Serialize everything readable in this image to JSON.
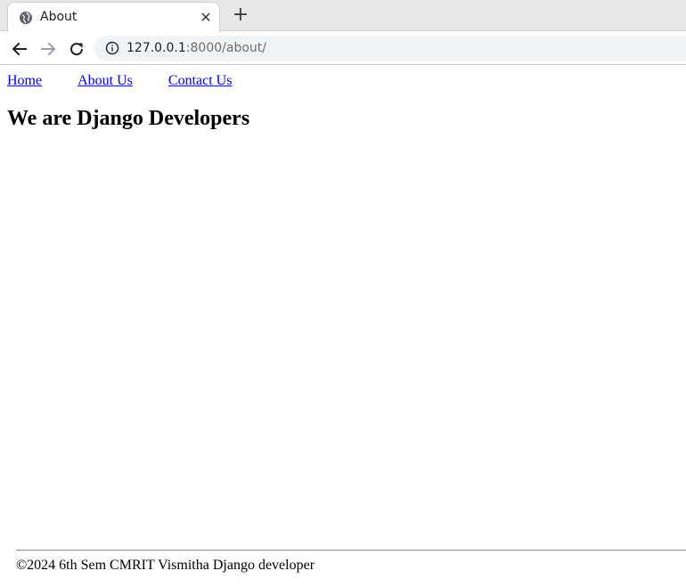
{
  "browser": {
    "tab_title": "About",
    "tab_close": "✕",
    "new_tab": "+",
    "url_host": "127.0.0.1",
    "url_rest": ":8000/about/"
  },
  "nav": {
    "home": "Home",
    "about": "About Us",
    "contact": "Contact Us"
  },
  "main": {
    "heading": "We are Django Developers"
  },
  "footer": {
    "text": "©2024 6th Sem CMRIT Vismitha Django developer"
  },
  "colors": {
    "link": "#0000ee",
    "tabstrip": "#e8e8e8",
    "omnibox": "#f1f3f4"
  }
}
